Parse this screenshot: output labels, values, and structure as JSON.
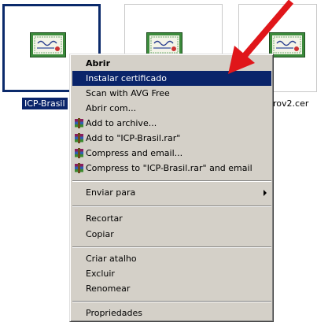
{
  "files": [
    {
      "label": "ICP-Brasil",
      "selected": true,
      "icon": "certificate-icon"
    },
    {
      "label": "",
      "selected": false,
      "icon": "certificate-icon"
    },
    {
      "label": "rov2.cer",
      "selected": false,
      "icon": "certificate-icon"
    }
  ],
  "context_menu": {
    "items": [
      {
        "label": "Abrir",
        "bold": true
      },
      {
        "label": "Instalar certificado",
        "highlighted": true
      },
      {
        "label": "Scan with AVG Free"
      },
      {
        "label": "Abrir com..."
      },
      {
        "label": "Add to archive...",
        "icon": "winrar-icon"
      },
      {
        "label": "Add to \"ICP-Brasil.rar\"",
        "icon": "winrar-icon"
      },
      {
        "label": "Compress and email...",
        "icon": "winrar-icon"
      },
      {
        "label": "Compress to \"ICP-Brasil.rar\" and email",
        "icon": "winrar-icon"
      },
      {
        "label": "Enviar para",
        "submenu": true
      },
      {
        "label": "Recortar"
      },
      {
        "label": "Copiar"
      },
      {
        "label": "Criar atalho"
      },
      {
        "label": "Excluir"
      },
      {
        "label": "Renomear"
      },
      {
        "label": "Propriedades"
      }
    ]
  },
  "colors": {
    "highlight": "#0a246a",
    "menu_bg": "#d4d0c8",
    "pointer_arrow": "#e0161a"
  }
}
